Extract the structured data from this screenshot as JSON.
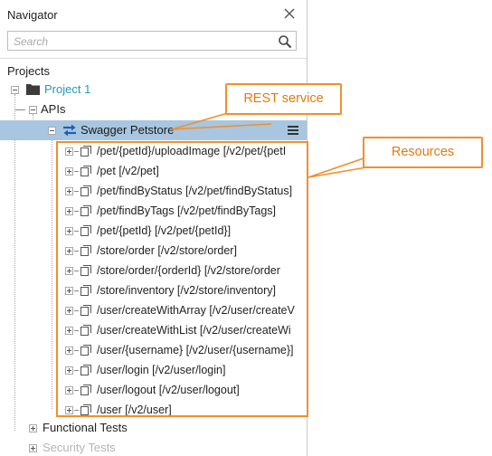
{
  "navigator": {
    "title": "Navigator",
    "close_icon": "close-icon",
    "search": {
      "placeholder": "Search",
      "icon": "search-icon"
    },
    "projects_label": "Projects"
  },
  "tree": {
    "project": {
      "label": "Project 1",
      "color": "#1e9bb5"
    },
    "apis_label": "APIs",
    "service": {
      "label": "Swagger Petstore",
      "menu_icon": "hamburger-menu-icon"
    },
    "resources": [
      "/pet/{petId}/uploadImage [/v2/pet/{petI",
      "/pet [/v2/pet]",
      "/pet/findByStatus [/v2/pet/findByStatus]",
      "/pet/findByTags [/v2/pet/findByTags]",
      "/pet/{petId} [/v2/pet/{petId}]",
      "/store/order [/v2/store/order]",
      "/store/order/{orderId} [/v2/store/order",
      "/store/inventory [/v2/store/inventory]",
      "/user/createWithArray [/v2/user/createV",
      "/user/createWithList [/v2/user/createWi",
      "/user/{username} [/v2/user/{username}]",
      "/user/login [/v2/user/login]",
      "/user/logout [/v2/user/logout]",
      "/user [/v2/user]"
    ],
    "functional_tests_label": "Functional Tests",
    "security_tests_label": "Security Tests"
  },
  "annotations": {
    "rest_service": "REST service",
    "resources": "Resources",
    "accent_color": "#f0902d"
  }
}
